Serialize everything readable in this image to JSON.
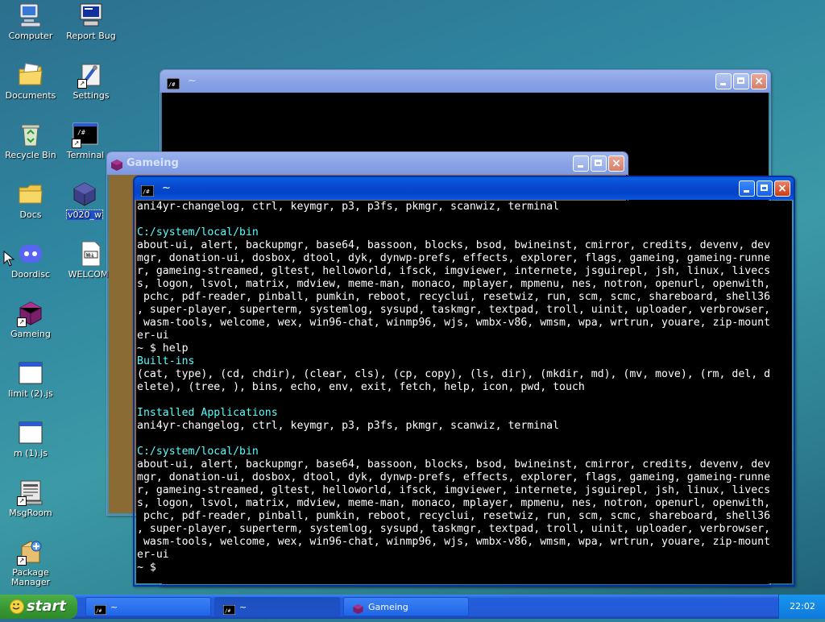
{
  "desktop": {
    "icons": [
      {
        "label": "Computer"
      },
      {
        "label": "Report Bug"
      },
      {
        "label": "Documents"
      },
      {
        "label": "Settings"
      },
      {
        "label": "Recycle Bin"
      },
      {
        "label": "Terminal"
      },
      {
        "label": "Docs"
      },
      {
        "label": "v020_w"
      },
      {
        "label": "Doordisc"
      },
      {
        "label": "WELCOME"
      },
      {
        "label": "Gameing"
      },
      {
        "label": "limit (2).js"
      },
      {
        "label": "m (1).js"
      },
      {
        "label": "MsgRoom"
      },
      {
        "label": "Package Manager"
      }
    ]
  },
  "windows": {
    "back_terminal": {
      "title": "~"
    },
    "gameing": {
      "title": "Gameing"
    },
    "front_terminal": {
      "title": "~",
      "lines": [
        "ani4yr-changelog, ctrl, keymgr, p3, p3fs, pkmgr, scanwiz, terminal",
        "",
        "C:/system/local/bin",
        "about-ui, alert, backupmgr, base64, bassoon, blocks, bsod, bwineinst, cmirror, credits, devenv, dev",
        "mgr, donation-ui, dosbox, dtool, dyk, dynwp-prefs, effects, explorer, flags, gameing, gameing-runne",
        "r, gameing-streamed, gltest, helloworld, ifsck, imgviewer, internete, jsguirepl, jsh, linux, livecs",
        "s, logon, lsvol, matrix, mdview, meme-man, monaco, mplayer, mpmenu, nes, notron, openurl, openwith,",
        " pchc, pdf-reader, pinball, pumkin, reboot, recyclui, resetwiz, run, scm, scmc, shareboard, shell36",
        ", super-player, superterm, systemlog, sysupd, taskmgr, textpad, troll, uinit, uploader, verbrowser,",
        " wasm-tools, welcome, wex, win96-chat, winmp96, wjs, wmbx-v86, wmsm, wpa, wrtrun, youare, zip-mount",
        "er-ui",
        "~ $ help",
        "Built-ins",
        "(cat, type), (cd, chdir), (clear, cls), (cp, copy), (ls, dir), (mkdir, md), (mv, move), (rm, del, d",
        "elete), (tree, ), bins, echo, env, exit, fetch, help, icon, pwd, touch",
        "",
        "Installed Applications",
        "ani4yr-changelog, ctrl, keymgr, p3, p3fs, pkmgr, scanwiz, terminal",
        "",
        "C:/system/local/bin",
        "about-ui, alert, backupmgr, base64, bassoon, blocks, bsod, bwineinst, cmirror, credits, devenv, dev",
        "mgr, donation-ui, dosbox, dtool, dyk, dynwp-prefs, effects, explorer, flags, gameing, gameing-runne",
        "r, gameing-streamed, gltest, helloworld, ifsck, imgviewer, internete, jsguirepl, jsh, linux, livecs",
        "s, logon, lsvol, matrix, mdview, meme-man, monaco, mplayer, mpmenu, nes, notron, openurl, openwith,",
        " pchc, pdf-reader, pinball, pumkin, reboot, recyclui, resetwiz, run, scm, scmc, shareboard, shell36",
        ", super-player, superterm, systemlog, sysupd, taskmgr, textpad, troll, uinit, uploader, verbrowser,",
        " wasm-tools, welcome, wex, win96-chat, winmp96, wjs, wmbx-v86, wmsm, wpa, wrtrun, youare, zip-mount",
        "er-ui",
        "~ $"
      ],
      "line_colors": [
        "#ffffff",
        "#ffffff",
        "#55ffff",
        "#ffffff",
        "#ffffff",
        "#ffffff",
        "#ffffff",
        "#ffffff",
        "#ffffff",
        "#ffffff",
        "#ffffff",
        "#ffffff",
        "#55ffff",
        "#ffffff",
        "#ffffff",
        "#ffffff",
        "#55ffff",
        "#ffffff",
        "#ffffff",
        "#55ffff",
        "#ffffff",
        "#ffffff",
        "#ffffff",
        "#ffffff",
        "#ffffff",
        "#ffffff",
        "#ffffff",
        "#ffffff",
        "#ffffff"
      ]
    }
  },
  "taskbar": {
    "start_label": "start",
    "tasks": [
      {
        "label": "~"
      },
      {
        "label": "~"
      },
      {
        "label": "Gameing"
      }
    ],
    "clock": "22:02"
  },
  "colors": {
    "accent": "#0a5fe0",
    "terminal_bg": "#000000",
    "terminal_heading": "#55ffff",
    "start_green": "#3a9a36"
  }
}
